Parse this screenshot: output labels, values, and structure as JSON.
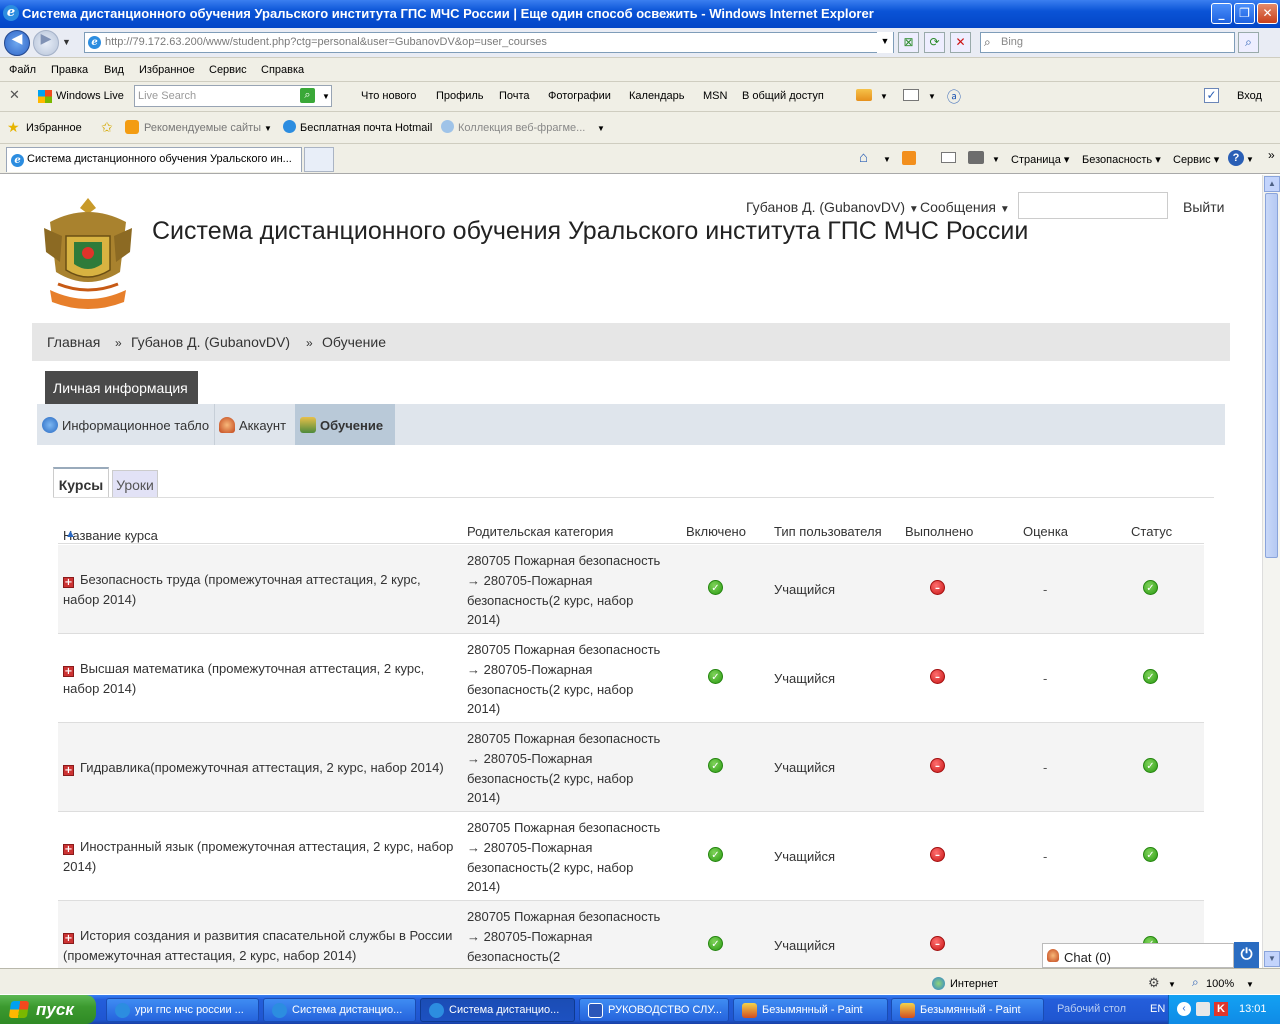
{
  "window": {
    "title": "Система дистанционного обучения Уральского института ГПС МЧС России | Еще один способ освежить  - Windows Internet Explorer"
  },
  "address": {
    "url": "http://79.172.63.200/www/student.php?ctg=personal&user=GubanovDV&op=user_courses",
    "search_placeholder": "Bing"
  },
  "menu": [
    "Файл",
    "Правка",
    "Вид",
    "Избранное",
    "Сервис",
    "Справка"
  ],
  "windows_live": {
    "brand": "Windows Live",
    "search_placeholder": "Live Search",
    "links": [
      "Что нового",
      "Профиль",
      "Почта",
      "Фотографии",
      "Календарь",
      "MSN",
      "В общий доступ"
    ],
    "signin": "Вход"
  },
  "favorites": {
    "label": "Избранное",
    "items": [
      "Рекомендуемые сайты",
      "Бесплатная почта Hotmail",
      "Коллекция веб-фрагме..."
    ]
  },
  "tabs": {
    "active_tab": "Система дистанционного обучения Уральского ин...",
    "commands": [
      "Страница",
      "Безопасность",
      "Сервис"
    ]
  },
  "header": {
    "site_title": "Система дистанционного обучения Уральского института ГПС МЧС России",
    "user_menu": "Губанов Д. (GubanovDV)",
    "messages": "Сообщения",
    "logout": "Выйти"
  },
  "breadcrumb": [
    "Главная",
    "»",
    "Губанов Д. (GubanovDV)",
    "»",
    "Обучение"
  ],
  "personal": {
    "header": "Личная информация",
    "nav": [
      "Информационное табло",
      "Аккаунт",
      "Обучение"
    ]
  },
  "subtabs": [
    "Курсы",
    "Уроки"
  ],
  "table": {
    "columns": [
      "Название курса",
      "Родительская категория",
      "Включено",
      "Тип пользователя",
      "Выполнено",
      "Оценка",
      "Статус"
    ],
    "rows": [
      {
        "name": "Безопасность труда (промежуточная аттестация, 2 курс, набор 2014)",
        "category": "280705 Пожарная безопасность → 280705-Пожарная безопасность(2 курс, набор 2014)",
        "enabled": true,
        "user_type": "Учащийся",
        "completed": false,
        "grade": "-",
        "status": true
      },
      {
        "name": "Высшая математика (промежуточная аттестация, 2 курс, набор 2014)",
        "category": "280705 Пожарная безопасность → 280705-Пожарная безопасность(2 курс, набор 2014)",
        "enabled": true,
        "user_type": "Учащийся",
        "completed": false,
        "grade": "-",
        "status": true
      },
      {
        "name": "Гидравлика(промежуточная аттестация, 2 курс, набор 2014)",
        "category": "280705 Пожарная безопасность → 280705-Пожарная безопасность(2 курс, набор 2014)",
        "enabled": true,
        "user_type": "Учащийся",
        "completed": false,
        "grade": "-",
        "status": true
      },
      {
        "name": "Иностранный язык (промежуточная аттестация, 2 курс, набор 2014)",
        "category": "280705 Пожарная безопасность → 280705-Пожарная безопасность(2 курс, набор 2014)",
        "enabled": true,
        "user_type": "Учащийся",
        "completed": false,
        "grade": "-",
        "status": true
      },
      {
        "name": "История создания и развития спасательной службы в России (промежуточная аттестация, 2 курс, набор 2014)",
        "category": "280705 Пожарная безопасность → 280705-Пожарная безопасность(2",
        "enabled": true,
        "user_type": "Учащийся",
        "completed": false,
        "grade": "",
        "status": true
      }
    ]
  },
  "chat": {
    "label": "Chat (0)"
  },
  "status": {
    "zone": "Интернет",
    "zoom": "100%"
  },
  "taskbar": {
    "start": "пуск",
    "tasks": [
      "ури гпс мчс россии ...",
      "Система дистанцио...",
      "Система дистанцио...",
      "РУКОВОДСТВО СЛУ...",
      "Безымянный - Paint",
      "Безымянный - Paint"
    ],
    "desktop": "Рабочий стол",
    "lang": "EN",
    "time": "13:01"
  }
}
